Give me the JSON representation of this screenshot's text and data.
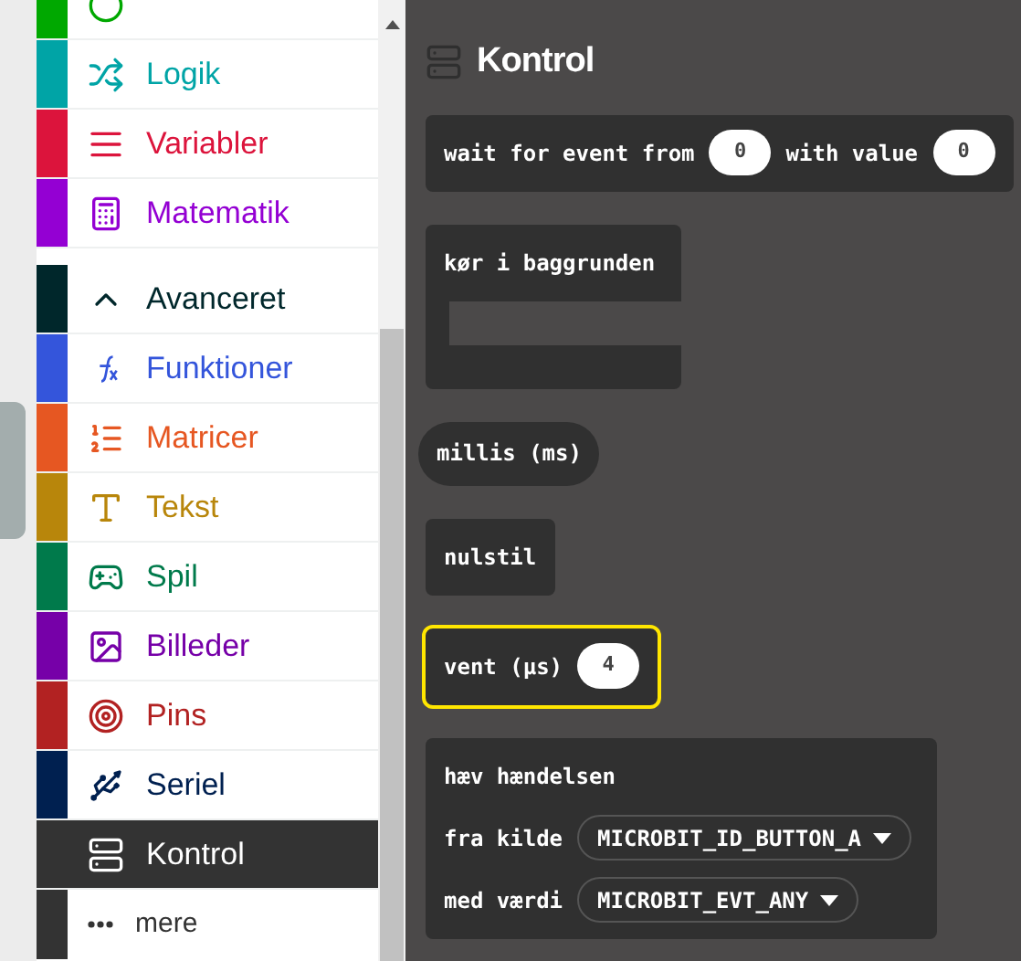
{
  "toolbox": {
    "categories": [
      {
        "kind": "category",
        "color": "#00a800",
        "selected": false
      },
      {
        "kind": "category",
        "label": "Logik",
        "color": "#00a4a6",
        "selected": false
      },
      {
        "kind": "category",
        "label": "Variabler",
        "color": "#dc143c",
        "selected": false
      },
      {
        "kind": "category",
        "label": "Matematik",
        "color": "#9400d3",
        "selected": false
      },
      {
        "kind": "toggle",
        "label": "Avanceret",
        "color": "#00272b",
        "selected": false
      },
      {
        "kind": "category",
        "label": "Funktioner",
        "color": "#3455db",
        "selected": false
      },
      {
        "kind": "category",
        "label": "Matricer",
        "color": "#e65722",
        "selected": false
      },
      {
        "kind": "category",
        "label": "Tekst",
        "color": "#b8860b",
        "selected": false
      },
      {
        "kind": "category",
        "label": "Spil",
        "color": "#007a4b",
        "selected": false
      },
      {
        "kind": "category",
        "label": "Billeder",
        "color": "#7600a8",
        "selected": false
      },
      {
        "kind": "category",
        "label": "Pins",
        "color": "#b22222",
        "selected": false
      },
      {
        "kind": "category",
        "label": "Seriel",
        "color": "#002050",
        "selected": false
      },
      {
        "kind": "category",
        "label": "Kontrol",
        "selected": true
      },
      {
        "kind": "more",
        "label": "mere",
        "selected": false
      }
    ]
  },
  "flyout": {
    "title": "Kontrol",
    "blocks": [
      {
        "kind": "statement",
        "parts": [
          {
            "kind": "text",
            "value": "wait for event from"
          },
          {
            "kind": "number",
            "value": "0"
          },
          {
            "kind": "text",
            "value": "with value"
          },
          {
            "kind": "number",
            "value": "0"
          }
        ],
        "selected": false
      },
      {
        "kind": "c-block",
        "parts": [
          {
            "kind": "text",
            "value": "kør i baggrunden"
          }
        ],
        "selected": false
      },
      {
        "kind": "reporter",
        "parts": [
          {
            "kind": "text",
            "value": "millis (ms)"
          }
        ],
        "selected": false
      },
      {
        "kind": "statement",
        "parts": [
          {
            "kind": "text",
            "value": "nulstil"
          }
        ],
        "selected": false
      },
      {
        "kind": "statement",
        "parts": [
          {
            "kind": "text",
            "value": "vent (µs)"
          },
          {
            "kind": "number",
            "value": "4"
          }
        ],
        "selected": true
      },
      {
        "kind": "multiline",
        "lines": [
          [
            {
              "kind": "text",
              "value": "hæv hændelsen"
            }
          ],
          [
            {
              "kind": "text",
              "value": "fra kilde"
            },
            {
              "kind": "dropdown",
              "value": "MICROBIT_ID_BUTTON_A"
            }
          ],
          [
            {
              "kind": "text",
              "value": "med værdi"
            },
            {
              "kind": "dropdown",
              "value": "MICROBIT_EVT_ANY"
            }
          ]
        ],
        "selected": false
      }
    ]
  }
}
